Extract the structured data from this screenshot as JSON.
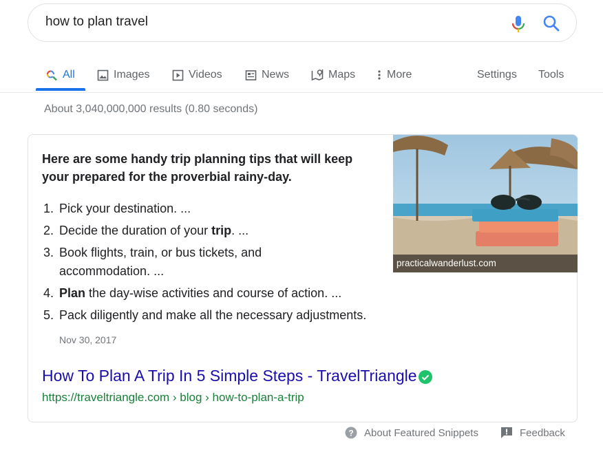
{
  "search": {
    "query": "how to plan travel"
  },
  "tabs": [
    {
      "label": "All",
      "icon": "search-icon",
      "active": true
    },
    {
      "label": "Images",
      "icon": "image-icon"
    },
    {
      "label": "Videos",
      "icon": "video-icon"
    },
    {
      "label": "News",
      "icon": "news-icon"
    },
    {
      "label": "Maps",
      "icon": "map-icon"
    },
    {
      "label": "More",
      "icon": "more-vert-icon"
    },
    {
      "label": "Settings"
    },
    {
      "label": "Tools"
    }
  ],
  "results_count": "About 3,040,000,000 results (0.80 seconds)",
  "snippet": {
    "heading": "Here are some handy trip planning tips that will keep your prepared for the proverbial rainy-day.",
    "steps": [
      {
        "num": "1.",
        "pre": "Pick your destination. ...",
        "bold": "",
        "post": ""
      },
      {
        "num": "2.",
        "pre": "Decide the duration of your ",
        "bold": "trip",
        "post": ". ..."
      },
      {
        "num": "3.",
        "pre": "Book flights, train, or bus tickets, and accommodation. ...",
        "bold": "",
        "post": ""
      },
      {
        "num": "4.",
        "pre": "",
        "bold": "Plan",
        "post": " the day-wise activities and course of action. ..."
      },
      {
        "num": "5.",
        "pre": "Pack diligently and make all the necessary adjustments.",
        "bold": "",
        "post": ""
      }
    ],
    "date": "Nov 30, 2017",
    "image_caption": "practicalwanderlust.com",
    "result_title": "How To Plan A Trip In 5 Simple Steps - TravelTriangle",
    "result_url": "https://traveltriangle.com › blog › how-to-plan-a-trip"
  },
  "footer": {
    "about_label": "About Featured Snippets",
    "feedback_label": "Feedback"
  },
  "colors": {
    "link": "#1a0dab",
    "url": "#188038",
    "accent": "#1a73e8",
    "verified": "#1ec36c"
  }
}
